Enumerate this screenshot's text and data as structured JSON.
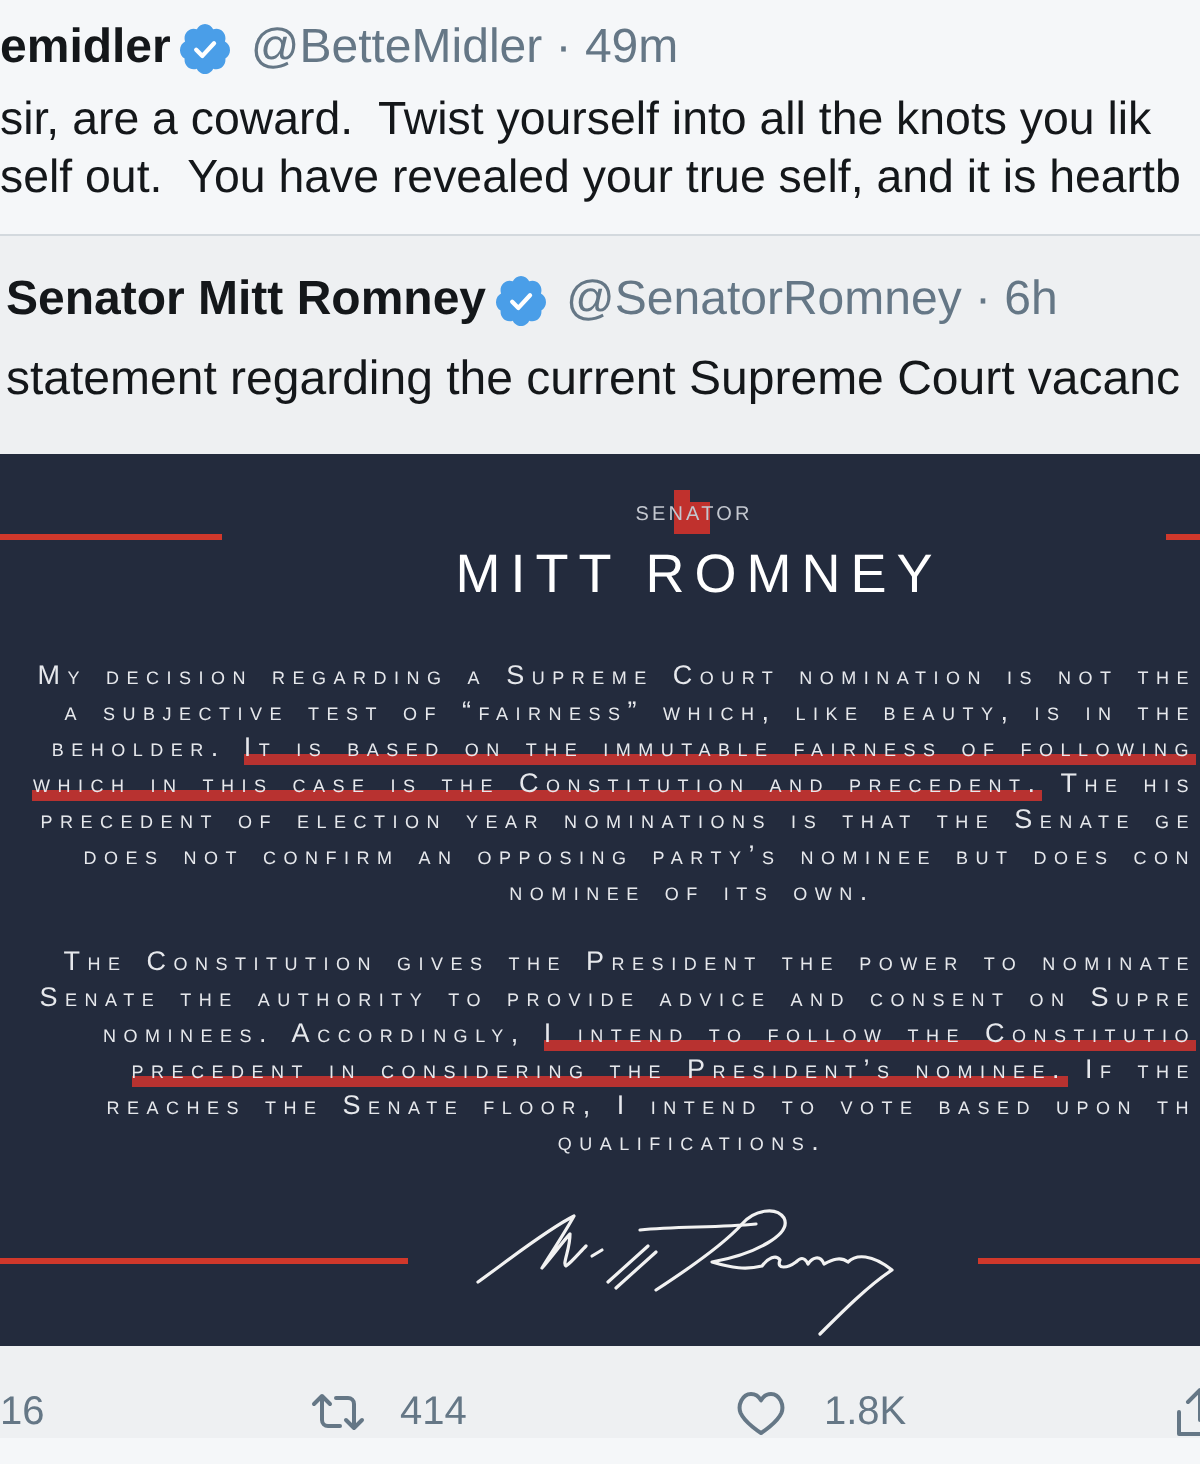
{
  "tweet": {
    "author_name": "emidler",
    "verified": true,
    "handle_line": "@BetteMidler · 49m",
    "text": "sir, are a coward.  Twist yourself into all the knots you lik\nself out.  You have revealed your true self, and it is heartb"
  },
  "quoted_tweet": {
    "author_name": "Senator Mitt Romney",
    "verified": true,
    "handle_line": "@SenatorRomney · 6h",
    "text": "statement regarding the current Supreme Court vacanc",
    "image": {
      "kicker": "SENATOR",
      "title": "MITT ROMNEY",
      "paragraphs": [
        {
          "lines": [
            {
              "kind": "clipped",
              "segments": [
                {
                  "text": "My decision regarding a Supreme Court nomination is not the",
                  "highlighted": false
                }
              ]
            },
            {
              "kind": "clipped",
              "segments": [
                {
                  "text": "a subjective test of “fairness” which, like beauty, is in the",
                  "highlighted": false
                }
              ]
            },
            {
              "kind": "clipped",
              "segments": [
                {
                  "text": "beholder.",
                  "highlighted": false
                },
                {
                  "text": "It is based on the immutable fairness of following",
                  "highlighted": true
                }
              ]
            },
            {
              "kind": "clipped",
              "segments": [
                {
                  "text": "which in this case is the Constitution and precedent.",
                  "highlighted": true
                },
                {
                  "text": "The his",
                  "highlighted": false
                }
              ]
            },
            {
              "kind": "clipped",
              "segments": [
                {
                  "text": "precedent of election year nominations is that the Senate ge",
                  "highlighted": false
                }
              ]
            },
            {
              "kind": "clipped",
              "segments": [
                {
                  "text": "does not confirm an opposing party’s nominee but does con",
                  "highlighted": false
                }
              ]
            },
            {
              "kind": "full",
              "segments": [
                {
                  "text": "nominee of its own.",
                  "highlighted": false
                }
              ]
            }
          ]
        },
        {
          "lines": [
            {
              "kind": "clipped",
              "segments": [
                {
                  "text": "The Constitution gives the President the power to nominate",
                  "highlighted": false
                }
              ]
            },
            {
              "kind": "clipped",
              "segments": [
                {
                  "text": "Senate the authority to provide advice and consent on Supre",
                  "highlighted": false
                }
              ]
            },
            {
              "kind": "clipped",
              "segments": [
                {
                  "text": "nominees. Accordingly,",
                  "highlighted": false
                },
                {
                  "text": "I intend to follow the Constitutio",
                  "highlighted": true
                }
              ]
            },
            {
              "kind": "clipped",
              "segments": [
                {
                  "text": "precedent in considering the President’s nominee.",
                  "highlighted": true
                },
                {
                  "text": "If the",
                  "highlighted": false
                }
              ]
            },
            {
              "kind": "clipped",
              "segments": [
                {
                  "text": "reaches the Senate floor, I intend to vote based upon th",
                  "highlighted": false
                }
              ]
            },
            {
              "kind": "full",
              "segments": [
                {
                  "text": "qualifications.",
                  "highlighted": false
                }
              ]
            }
          ]
        }
      ]
    }
  },
  "actions": [
    {
      "kind": "reply",
      "count": "16"
    },
    {
      "kind": "retweet",
      "count": "414"
    },
    {
      "kind": "like",
      "count": "1.8K"
    },
    {
      "kind": "share"
    }
  ]
}
